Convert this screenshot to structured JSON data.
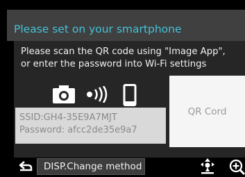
{
  "screen": {
    "title": "Please set on your smartphone",
    "instructions": {
      "line1": "Please scan the QR code using \"Image App\",",
      "line2": "or enter the password into Wi-Fi settings"
    },
    "connection": {
      "ssid": "SSID:GH4-35E9A7MJT",
      "password": "Password: afcc2de35e9a7"
    },
    "qr_label": "QR Cord",
    "icons": [
      "camera-icon",
      "wifi-signal-icon",
      "smartphone-icon",
      "back-arrow-icon",
      "location-pointer-icon",
      "zoom-in-icon"
    ],
    "footer": {
      "disp_button_label": "DISP.Change method"
    }
  },
  "colors": {
    "title": "#43c3d8",
    "background": "#000000",
    "panel": "#262626",
    "band": "#404040",
    "ssid_box": "#d9d9d9",
    "qr_box": "#f5f5f5"
  }
}
